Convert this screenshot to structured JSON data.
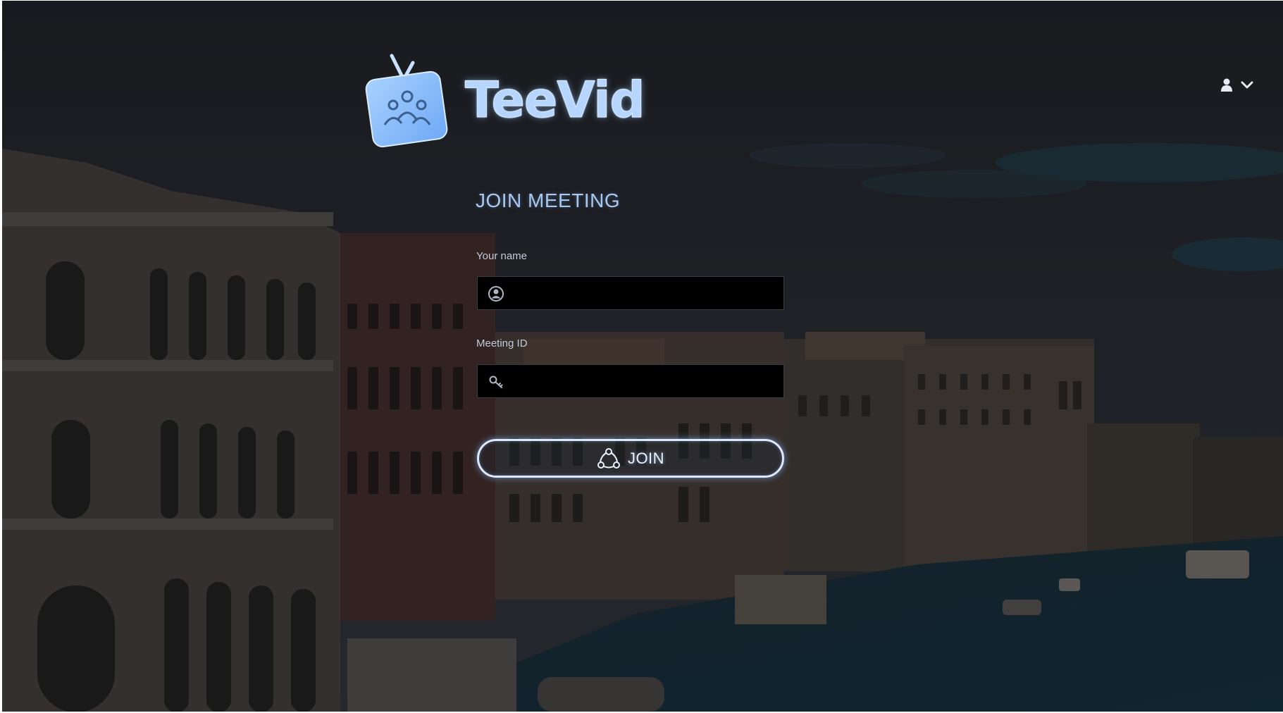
{
  "brand": {
    "name": "TeeVid",
    "icon": "tv-people-icon",
    "color": "#b6d6ff"
  },
  "header": {
    "user_menu": {
      "icon": "user-icon",
      "caret": "chevron-down-icon"
    }
  },
  "form": {
    "title": "JOIN MEETING",
    "name_field": {
      "label": "Your name",
      "value": "",
      "placeholder": "",
      "icon": "user-circle-icon"
    },
    "meeting_field": {
      "label": "Meeting ID",
      "value": "",
      "placeholder": "",
      "icon": "key-icon"
    },
    "join_button": {
      "label": "JOIN",
      "icon": "share-nodes-icon"
    }
  },
  "colors": {
    "background": "#1f2023",
    "accent": "#dce9ff",
    "title": "#a9c8f0",
    "input_bg": "#000000"
  }
}
